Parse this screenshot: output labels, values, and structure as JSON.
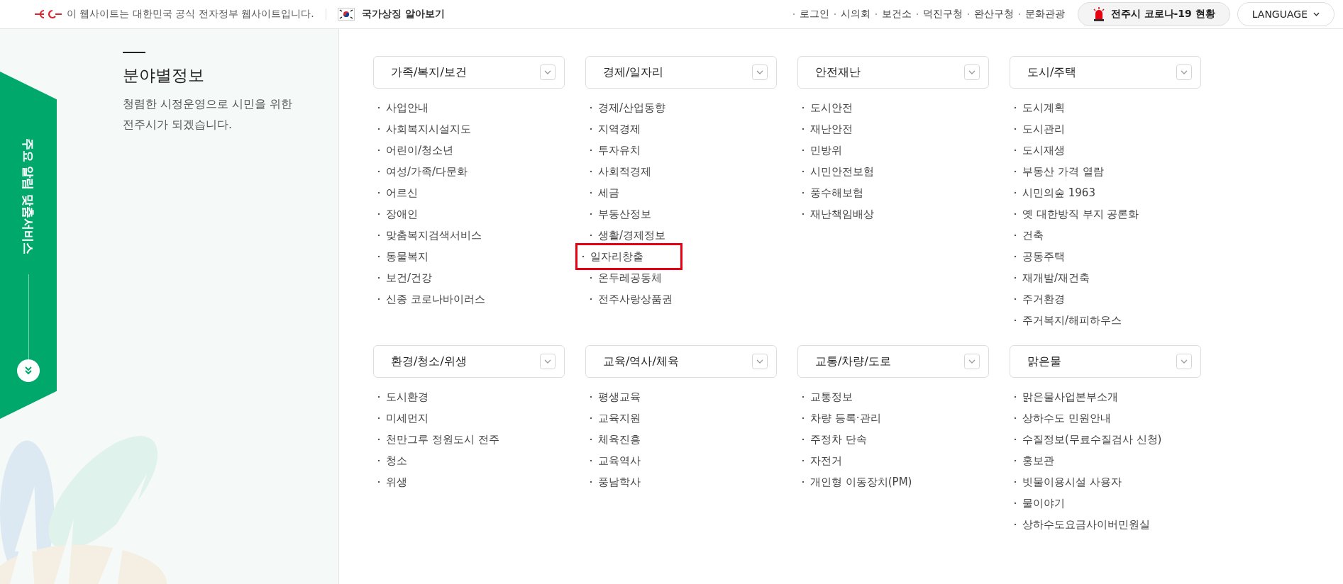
{
  "top_bar": {
    "notice": "이 웹사이트는 대한민국 공식 전자정부 웹사이트입니다.",
    "symbol_link": "국가상징 알아보기",
    "links": [
      "로그인",
      "시의회",
      "보건소",
      "덕진구청",
      "완산구청",
      "문화관광"
    ],
    "covid_button": "전주시 코로나-19 현황",
    "language_button": "LANGUAGE"
  },
  "side_tab": {
    "label": "주요 알림 맞춤서비스"
  },
  "intro": {
    "title": "분야별정보",
    "description": "청렴한 시정운영으로 시민을 위한 전주시가 되겠습니다."
  },
  "categories": [
    {
      "title": "가족/복지/보건",
      "items": [
        {
          "label": "사업안내",
          "highlighted": false
        },
        {
          "label": "사회복지시설지도",
          "highlighted": false
        },
        {
          "label": "어린이/청소년",
          "highlighted": false
        },
        {
          "label": "여성/가족/다문화",
          "highlighted": false
        },
        {
          "label": "어르신",
          "highlighted": false
        },
        {
          "label": "장애인",
          "highlighted": false
        },
        {
          "label": "맞춤복지검색서비스",
          "highlighted": false
        },
        {
          "label": "동물복지",
          "highlighted": false
        },
        {
          "label": "보건/건강",
          "highlighted": false
        },
        {
          "label": "신종 코로나바이러스",
          "highlighted": false
        }
      ]
    },
    {
      "title": "경제/일자리",
      "items": [
        {
          "label": "경제/산업동향",
          "highlighted": false
        },
        {
          "label": "지역경제",
          "highlighted": false
        },
        {
          "label": "투자유치",
          "highlighted": false
        },
        {
          "label": "사회적경제",
          "highlighted": false
        },
        {
          "label": "세금",
          "highlighted": false
        },
        {
          "label": "부동산정보",
          "highlighted": false
        },
        {
          "label": "생활/경제정보",
          "highlighted": false
        },
        {
          "label": "일자리창출",
          "highlighted": true
        },
        {
          "label": "온두레공동체",
          "highlighted": false
        },
        {
          "label": "전주사랑상품권",
          "highlighted": false
        }
      ]
    },
    {
      "title": "안전재난",
      "items": [
        {
          "label": "도시안전",
          "highlighted": false
        },
        {
          "label": "재난안전",
          "highlighted": false
        },
        {
          "label": "민방위",
          "highlighted": false
        },
        {
          "label": "시민안전보험",
          "highlighted": false
        },
        {
          "label": "풍수해보험",
          "highlighted": false
        },
        {
          "label": "재난책임배상",
          "highlighted": false
        }
      ]
    },
    {
      "title": "도시/주택",
      "items": [
        {
          "label": "도시계획",
          "highlighted": false
        },
        {
          "label": "도시관리",
          "highlighted": false
        },
        {
          "label": "도시재생",
          "highlighted": false
        },
        {
          "label": "부동산 가격 열람",
          "highlighted": false
        },
        {
          "label": "시민의숲 1963",
          "highlighted": false
        },
        {
          "label": "옛 대한방직 부지 공론화",
          "highlighted": false
        },
        {
          "label": "건축",
          "highlighted": false
        },
        {
          "label": "공동주택",
          "highlighted": false
        },
        {
          "label": "재개발/재건축",
          "highlighted": false
        },
        {
          "label": "주거환경",
          "highlighted": false
        },
        {
          "label": "주거복지/해피하우스",
          "highlighted": false
        }
      ]
    },
    {
      "title": "환경/청소/위생",
      "items": [
        {
          "label": "도시환경",
          "highlighted": false
        },
        {
          "label": "미세먼지",
          "highlighted": false
        },
        {
          "label": "천만그루 정원도시 전주",
          "highlighted": false
        },
        {
          "label": "청소",
          "highlighted": false
        },
        {
          "label": "위생",
          "highlighted": false
        }
      ]
    },
    {
      "title": "교육/역사/체육",
      "items": [
        {
          "label": "평생교육",
          "highlighted": false
        },
        {
          "label": "교육지원",
          "highlighted": false
        },
        {
          "label": "체육진흥",
          "highlighted": false
        },
        {
          "label": "교육역사",
          "highlighted": false
        },
        {
          "label": "풍남학사",
          "highlighted": false
        }
      ]
    },
    {
      "title": "교통/차량/도로",
      "items": [
        {
          "label": "교통정보",
          "highlighted": false
        },
        {
          "label": "차량 등록·관리",
          "highlighted": false
        },
        {
          "label": "주정차 단속",
          "highlighted": false
        },
        {
          "label": "자전거",
          "highlighted": false
        },
        {
          "label": "개인형 이동장치(PM)",
          "highlighted": false
        }
      ]
    },
    {
      "title": "맑은물",
      "items": [
        {
          "label": "맑은물사업본부소개",
          "highlighted": false
        },
        {
          "label": "상하수도 민원안내",
          "highlighted": false
        },
        {
          "label": "수질정보(무료수질검사 신청)",
          "highlighted": false
        },
        {
          "label": "홍보관",
          "highlighted": false
        },
        {
          "label": "빗물이용시설 사용자",
          "highlighted": false
        },
        {
          "label": "물이야기",
          "highlighted": false
        },
        {
          "label": "상하수도요금사이버민원실",
          "highlighted": false
        }
      ]
    }
  ]
}
